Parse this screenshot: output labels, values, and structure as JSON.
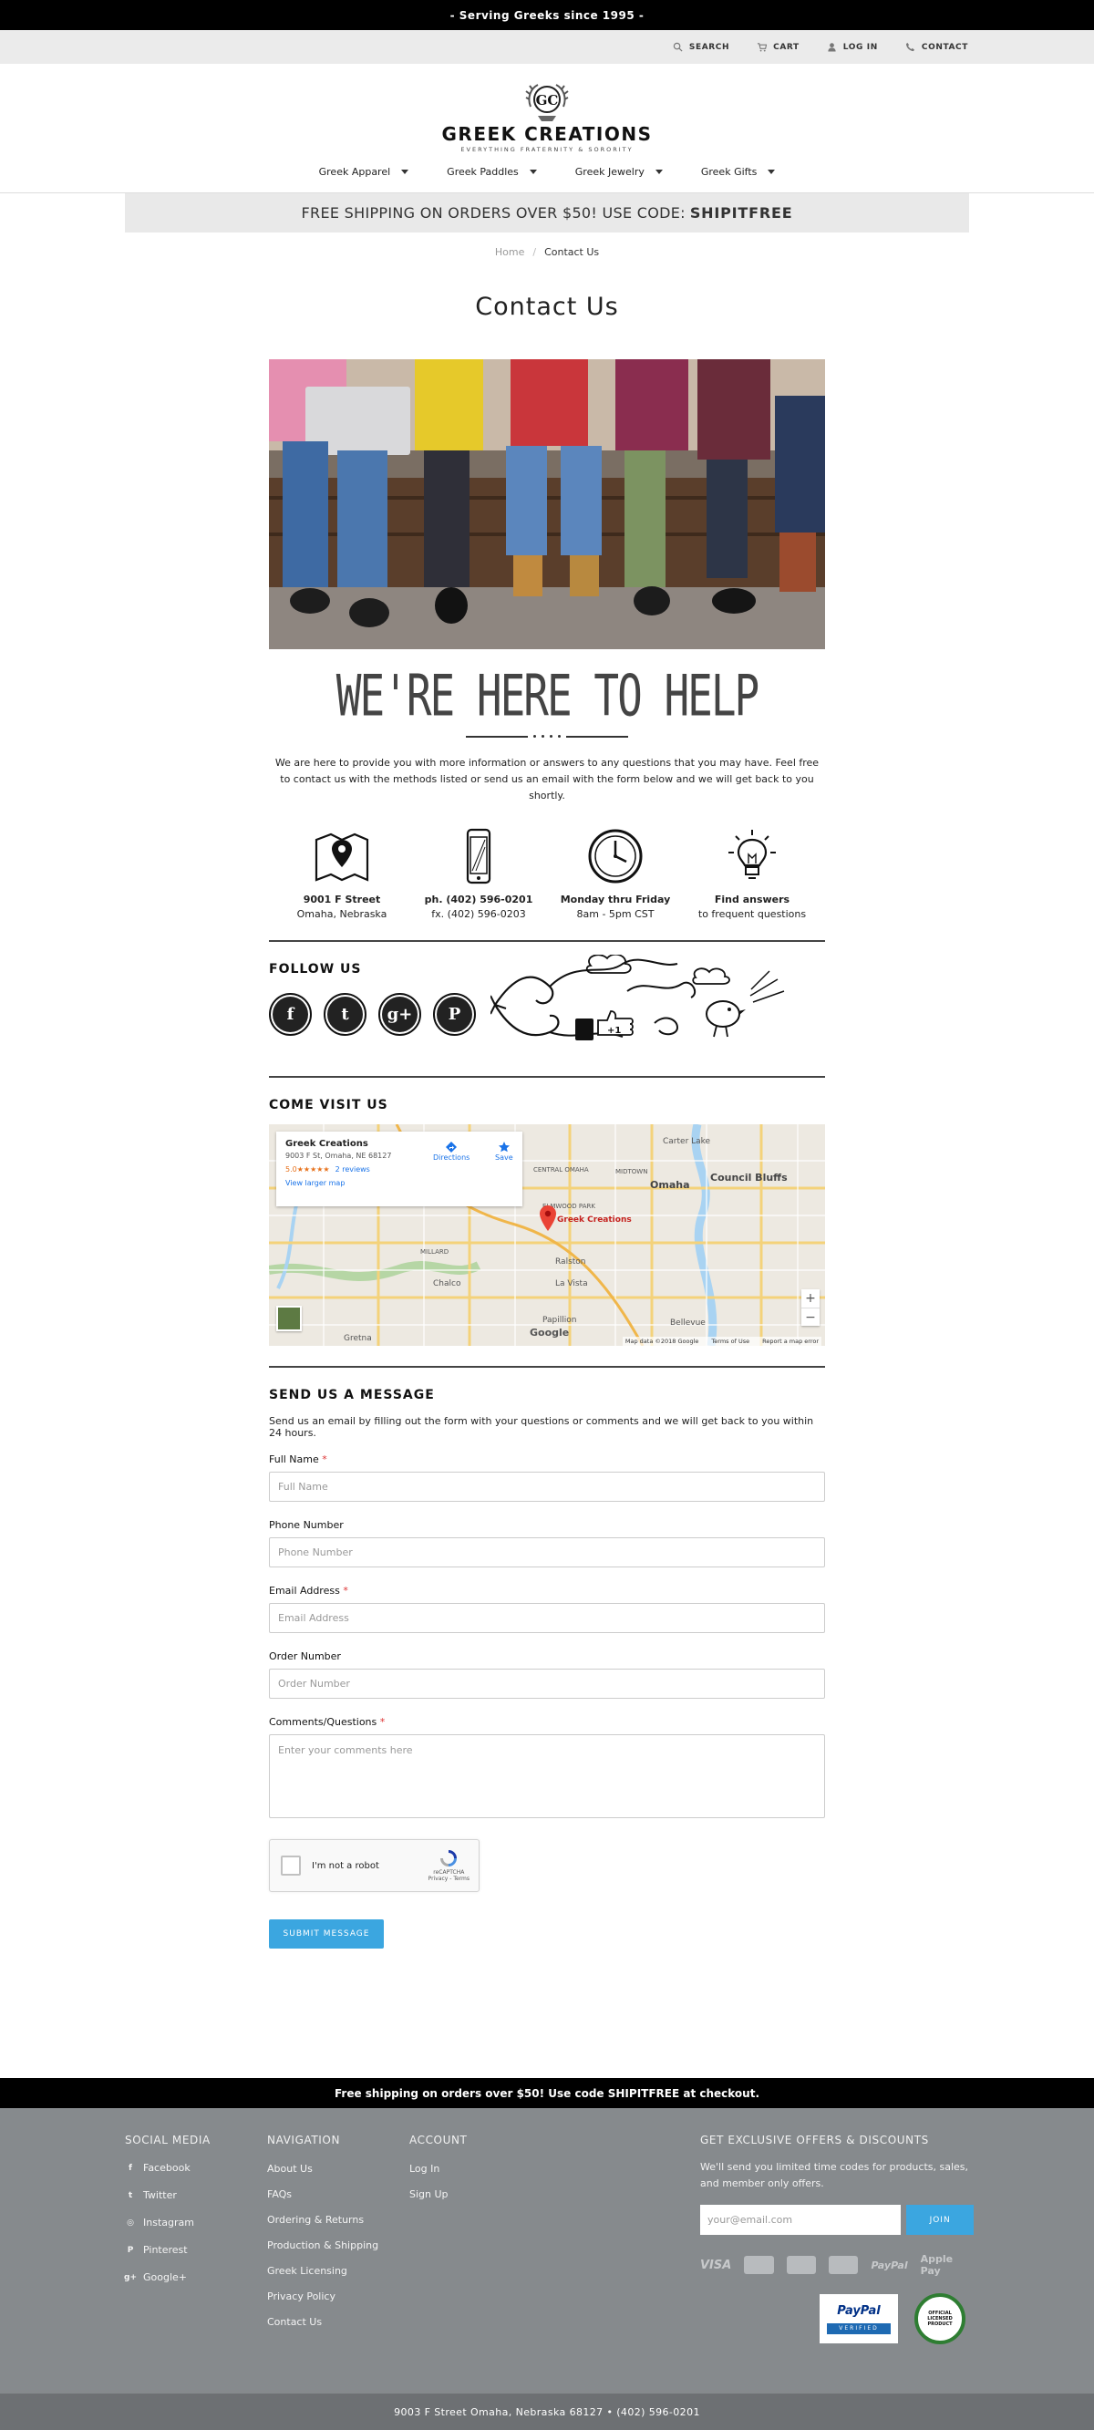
{
  "announcement": "- Serving Greeks since 1995 -",
  "utility_nav": [
    {
      "label": "SEARCH",
      "icon": "search-icon"
    },
    {
      "label": "CART",
      "icon": "cart-icon"
    },
    {
      "label": "LOG IN",
      "icon": "user-icon"
    },
    {
      "label": "CONTACT",
      "icon": "phone-icon"
    }
  ],
  "logo": {
    "monogram": "GC",
    "name": "GREEK CREATIONS",
    "tagline": "EVERYTHING FRATERNITY & SORORITY"
  },
  "main_nav": [
    {
      "label": "Greek Apparel"
    },
    {
      "label": "Greek Paddles"
    },
    {
      "label": "Greek Jewelry"
    },
    {
      "label": "Greek Gifts"
    }
  ],
  "shipping_banner": {
    "text": "FREE SHIPPING ON ORDERS OVER $50! USE CODE:",
    "code": "SHIPITFREE"
  },
  "breadcrumb": {
    "home": "Home",
    "separator": "/",
    "current": "Contact Us"
  },
  "page_title": "Contact Us",
  "help_heading": "WE'RE HERE TO HELP",
  "intro": "We are here to provide you with more information or answers to any questions that you may have. Feel free to contact us with the methods listed or send us an email with the form below and we will get back to you shortly.",
  "info": [
    {
      "icon": "map-icon",
      "line1": "9001 F Street",
      "line2": "Omaha, Nebraska"
    },
    {
      "icon": "smartphone-icon",
      "line1": "ph. (402) 596-0201",
      "line2": "fx. (402) 596-0203"
    },
    {
      "icon": "clock-icon",
      "line1": "Monday thru Friday",
      "line2": "8am - 5pm CST"
    },
    {
      "icon": "lightbulb-icon",
      "line1": "Find answers",
      "line2": "to frequent questions"
    }
  ],
  "follow": {
    "title": "FOLLOW US",
    "networks": [
      {
        "icon": "facebook-icon",
        "glyph": "f"
      },
      {
        "icon": "twitter-icon",
        "glyph": "t"
      },
      {
        "icon": "google-plus-icon",
        "glyph": "g+"
      },
      {
        "icon": "pinterest-icon",
        "glyph": "P"
      }
    ]
  },
  "visit": {
    "title": "COME VISIT US",
    "map": {
      "place_name": "Greek Creations",
      "address": "9003 F St, Omaha, NE 68127",
      "rating": "5.0",
      "stars": "★★★★★",
      "reviews": "2 reviews",
      "view_larger": "View larger map",
      "directions": "Directions",
      "save": "Save",
      "pin_label": "Greek Creations",
      "labels": [
        "Carter Lake",
        "Omaha",
        "Council Bluffs",
        "Ralston",
        "La Vista",
        "Chalco",
        "Bellevue",
        "Papillion",
        "Gretna",
        "MILLARD",
        "MIDTOWN",
        "CENTRAL OMAHA",
        "ELMWOOD PARK"
      ],
      "zoom_in": "+",
      "zoom_out": "−",
      "attribution": "Map data ©2018 Google",
      "terms": "Terms of Use",
      "report": "Report a map error",
      "google": "Google"
    }
  },
  "send": {
    "title": "SEND US A MESSAGE",
    "subtitle": "Send us an email by filling out the form with your questions or comments and we will get back to you within 24 hours.",
    "fields": [
      {
        "label": "Full Name",
        "required": "*",
        "placeholder": "Full Name"
      },
      {
        "label": "Phone Number",
        "required": "",
        "placeholder": "Phone Number"
      },
      {
        "label": "Email Address",
        "required": "*",
        "placeholder": "Email Address"
      },
      {
        "label": "Order Number",
        "required": "",
        "placeholder": "Order Number"
      },
      {
        "label": "Comments/Questions",
        "required": "*",
        "placeholder": "Enter your comments here"
      }
    ],
    "captcha": {
      "label": "I'm not a robot",
      "brand": "reCAPTCHA",
      "links": "Privacy - Terms"
    },
    "submit": "SUBMIT MESSAGE"
  },
  "footer": {
    "promo": "Free shipping on orders over $50! Use code SHIPITFREE at checkout.",
    "social_title": "SOCIAL MEDIA",
    "social": [
      {
        "label": "Facebook",
        "icon": "facebook-icon",
        "glyph": "f"
      },
      {
        "label": "Twitter",
        "icon": "twitter-icon",
        "glyph": "t"
      },
      {
        "label": "Instagram",
        "icon": "instagram-icon",
        "glyph": "◎"
      },
      {
        "label": "Pinterest",
        "icon": "pinterest-icon",
        "glyph": "P"
      },
      {
        "label": "Google+",
        "icon": "google-plus-icon",
        "glyph": "g+"
      }
    ],
    "nav_title": "NAVIGATION",
    "nav": [
      "About Us",
      "FAQs",
      "Ordering & Returns",
      "Production & Shipping",
      "Greek Licensing",
      "Privacy Policy",
      "Contact Us"
    ],
    "account_title": "ACCOUNT",
    "account": [
      "Log In",
      "Sign Up"
    ],
    "offers_title": "GET EXCLUSIVE OFFERS & DISCOUNTS",
    "offers_text": "We'll send you limited time codes for products, sales, and member only offers.",
    "email_placeholder": "your@email.com",
    "join": "JOIN",
    "payments": [
      "VISA",
      "mastercard-icon",
      "amex-icon",
      "discover-icon",
      "PayPal",
      "Apple Pay"
    ],
    "paypal_badge": {
      "brand": "PayPal",
      "verified": "VERIFIED"
    },
    "licensed_badge": "OFFICIAL LICENSED PRODUCT",
    "bottom": "9003 F Street Omaha, Nebraska 68127 • (402) 596-0201"
  }
}
